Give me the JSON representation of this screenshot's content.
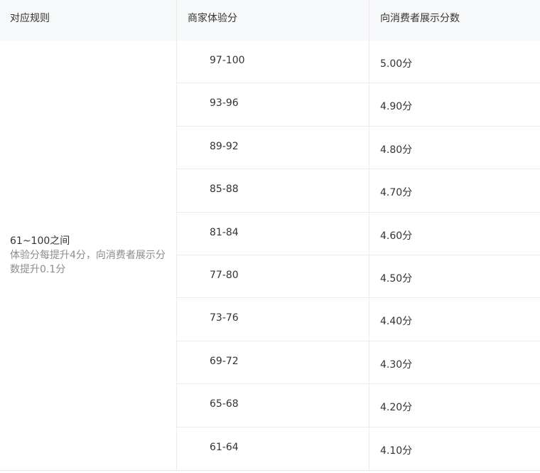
{
  "header": {
    "col_rule": "对应规则",
    "col_merchant_score": "商家体验分",
    "col_display_score": "向消费者展示分数"
  },
  "rule": {
    "main": "61~100之间",
    "sub": "体验分每提升4分，向消费者展示分数提升0.1分"
  },
  "rows": [
    {
      "range": "97-100",
      "score": "5.00分"
    },
    {
      "range": "93-96",
      "score": "4.90分"
    },
    {
      "range": "89-92",
      "score": "4.80分"
    },
    {
      "range": "85-88",
      "score": "4.70分"
    },
    {
      "range": "81-84",
      "score": "4.60分"
    },
    {
      "range": "77-80",
      "score": "4.50分"
    },
    {
      "range": "73-76",
      "score": "4.40分"
    },
    {
      "range": "69-72",
      "score": "4.30分"
    },
    {
      "range": "65-68",
      "score": "4.20分"
    },
    {
      "range": "61-64",
      "score": "4.10分"
    }
  ]
}
